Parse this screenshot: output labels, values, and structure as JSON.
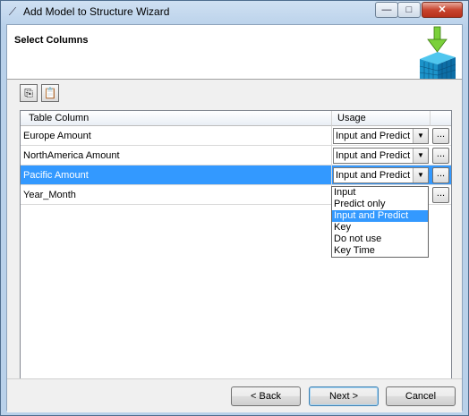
{
  "window": {
    "title": "Add Model to Structure Wizard",
    "controls": {
      "minimize": "—",
      "maximize": "□",
      "close": "✕"
    }
  },
  "header": {
    "title": "Select Columns"
  },
  "toolbar": {
    "icons": [
      "copy-icon",
      "paste-icon"
    ]
  },
  "grid": {
    "columns": [
      "Table Column",
      "Usage"
    ],
    "rows": [
      {
        "name": "Europe Amount",
        "usage": "Input and Predict"
      },
      {
        "name": "NorthAmerica Amount",
        "usage": "Input and Predict"
      },
      {
        "name": "Pacific Amount",
        "usage": "Input and Predict",
        "selected": true
      },
      {
        "name": "Year_Month",
        "usage": ""
      }
    ],
    "ellipsis": "..."
  },
  "dropdown": {
    "options": [
      "Input",
      "Predict only",
      "Input and Predict",
      "Key",
      "Do not use",
      "Key Time"
    ],
    "highlighted": "Input and Predict"
  },
  "footer": {
    "back": "< Back",
    "next": "Next >",
    "cancel": "Cancel"
  }
}
